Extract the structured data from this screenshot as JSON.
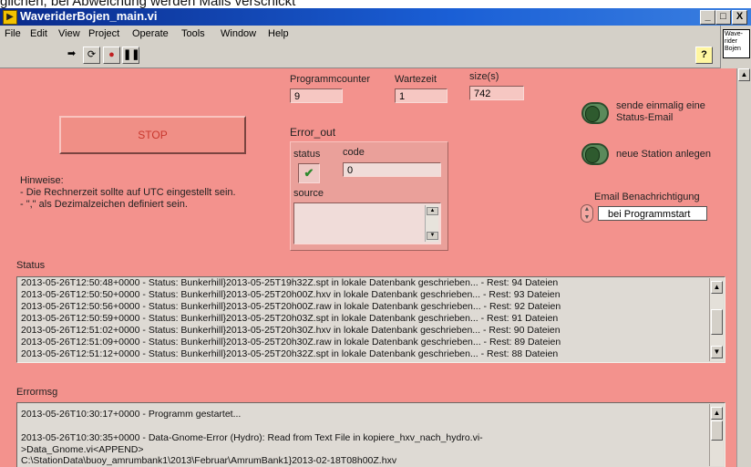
{
  "caption": "glichen, bei Abweichung werden Mails verschickt",
  "window": {
    "title": "WaveriderBojen_main.vi",
    "controls": [
      "_",
      "□",
      "X"
    ],
    "icon_text": "Wave- rider Bojen"
  },
  "menu": [
    "File",
    "Edit",
    "View",
    "Project",
    "Operate",
    "Tools",
    "Window",
    "Help"
  ],
  "toolbar": {
    "icons": [
      "run-arrow-icon",
      "run-continuous-icon",
      "abort-icon",
      "pause-icon"
    ],
    "help_label": "?"
  },
  "indicators": {
    "programmcounter": {
      "label": "Programmcounter",
      "value": "9"
    },
    "wartezeit": {
      "label": "Wartezeit",
      "value": "1"
    },
    "size": {
      "label": "size(s)",
      "value": "742"
    }
  },
  "stop_button": {
    "label": "STOP"
  },
  "error_out": {
    "title": "Error_out",
    "status_label": "status",
    "code_label": "code",
    "code_value": "0",
    "source_label": "source",
    "status_glyph": "✔"
  },
  "hinweise": [
    "Hinweise:",
    "- Die Rechnerzeit sollte auf UTC eingestellt sein.",
    "- \",\" als Dezimalzeichen definiert sein."
  ],
  "switches": {
    "email_once": "sende einmalig eine Status-Email",
    "new_station": "neue Station anlegen"
  },
  "email_notification": {
    "label": "Email Benachrichtigung",
    "value": "bei Programmstart"
  },
  "status": {
    "label": "Status",
    "lines": [
      "2013-05-26T12:50:48+0000 - Status: Bunkerhill}2013-05-25T19h32Z.spt in lokale Datenbank geschrieben...  - Rest: 94 Dateien",
      "2013-05-26T12:50:50+0000 - Status: Bunkerhill}2013-05-25T20h00Z.hxv in lokale Datenbank geschrieben...  - Rest: 93 Dateien",
      "2013-05-26T12:50:56+0000 - Status: Bunkerhill}2013-05-25T20h00Z.raw in lokale Datenbank geschrieben...  - Rest: 92 Dateien",
      "2013-05-26T12:50:59+0000 - Status: Bunkerhill}2013-05-25T20h03Z.spt in lokale Datenbank geschrieben...  - Rest: 91 Dateien",
      "2013-05-26T12:51:02+0000 - Status: Bunkerhill}2013-05-25T20h30Z.hxv in lokale Datenbank geschrieben...  - Rest: 90 Dateien",
      "2013-05-26T12:51:09+0000 - Status: Bunkerhill}2013-05-25T20h30Z.raw in lokale Datenbank geschrieben...  - Rest: 89 Dateien",
      "2013-05-26T12:51:12+0000 - Status: Bunkerhill}2013-05-25T20h32Z.spt in lokale Datenbank geschrieben...  - Rest: 88 Dateien"
    ]
  },
  "errormsg": {
    "label": "Errormsg",
    "lines": [
      "2013-05-26T10:30:17+0000 - Programm gestartet...",
      "",
      "2013-05-26T10:30:35+0000 - Data-Gnome-Error (Hydro): Read from Text File in kopiere_hxv_nach_hydro.vi-",
      ">Data_Gnome.vi<APPEND>",
      "C:\\StationData\\buoy_amrumbank1\\2013\\Februar\\AmrumBank1}2013-02-18T08h00Z.hxv"
    ]
  },
  "colors": {
    "panel": "#f3928d",
    "titlebar": "#1a5fd6",
    "chrome": "#d4d0c8"
  }
}
